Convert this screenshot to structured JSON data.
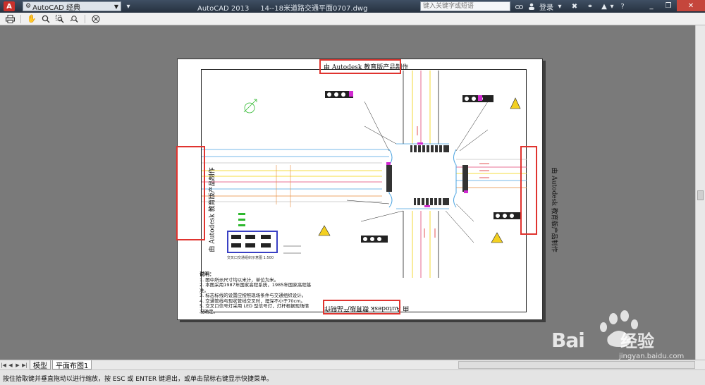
{
  "titlebar": {
    "app_logo": "A",
    "workspace": "AutoCAD 经典",
    "app_name": "AutoCAD 2013",
    "filename": "14--18米道路交通平面0707.dwg",
    "search_placeholder": "键入关键字或短语",
    "login_label": "登录",
    "icons": [
      "binoculars-icon",
      "user-icon",
      "cart-icon",
      "network-icon",
      "help-icon"
    ]
  },
  "toolbar": {
    "icons": [
      "print-icon",
      "pan-icon",
      "zoom-icon",
      "zoom-window-icon",
      "zoom-previous-icon",
      "close-preview-icon"
    ]
  },
  "sheet": {
    "stamp_text": "由 Autodesk 教育版产品制作",
    "notes_title": "说明：",
    "notes": [
      "1. 图中所示尺寸均以米计，单位为米。",
      "2. 本图采用1987年国家高程系统，1985年国家高程基准。",
      "3. 标志标线的设置应按照现场条件与交通组织设计。",
      "4. 交通管线与现状管线交叉时，埋深不小于70cm。",
      "5. 交叉口信号灯采用 LED 型信号灯，灯杆根据现场情况确定。"
    ],
    "legend_caption": "交叉口交通组织示意图 1:500"
  },
  "tabs": {
    "items": [
      {
        "label": "模型",
        "active": false
      },
      {
        "label": "平面布图1",
        "active": true
      }
    ]
  },
  "status": {
    "message": "按住拾取键并垂直拖动以进行缩放，按 ESC 或 ENTER 键退出，或单击鼠标右键显示快捷菜单。"
  },
  "watermark": {
    "brand": "Bai",
    "brand_cn": "经验",
    "url": "jingyan.baidu.com"
  },
  "colors": {
    "highlight": "#e0342f",
    "legend_border": "#3940c4"
  }
}
